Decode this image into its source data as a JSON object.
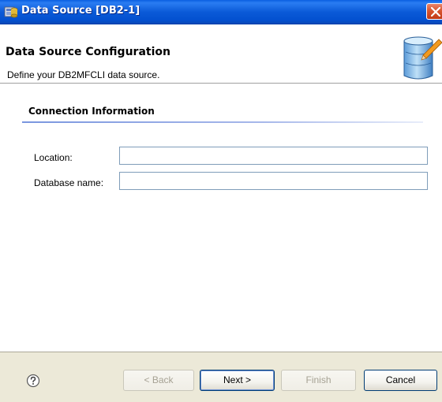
{
  "window": {
    "title": "Data Source [DB2-1]"
  },
  "banner": {
    "title": "Data Source Configuration",
    "description": "Define your DB2MFCLI data source."
  },
  "section": {
    "title": "Connection Information"
  },
  "fields": {
    "location": {
      "label": "Location:",
      "value": ""
    },
    "database_name": {
      "label": "Database name:",
      "value": ""
    }
  },
  "buttons": {
    "back": "< Back",
    "next": "Next >",
    "finish": "Finish",
    "cancel": "Cancel"
  },
  "icons": {
    "app": "data-source-app-icon",
    "close": "close-icon",
    "banner": "database-cylinder-icon",
    "help": "help-icon"
  },
  "colors": {
    "titlebar": "#0a5ad8",
    "dialog_background": "#ece9d8",
    "input_border": "#7f9db9",
    "section_rule": "#7a96df"
  }
}
